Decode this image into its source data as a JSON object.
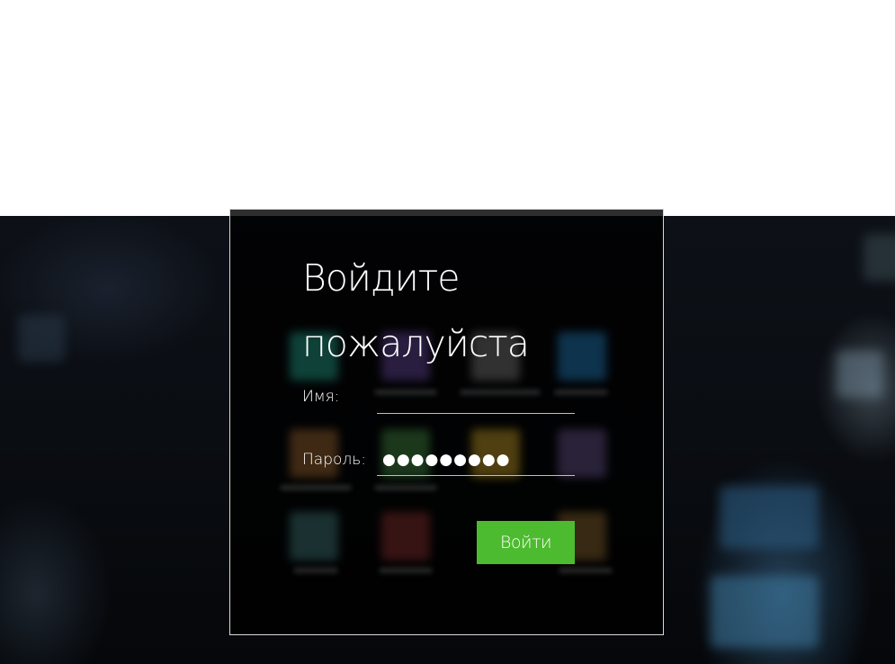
{
  "login": {
    "heading": "Войдите пожалуйста",
    "name_label": "Имя:",
    "name_value": "",
    "password_label": "Пароль:",
    "password_masked": "●●●●●●●●●",
    "submit_label": "Войти"
  },
  "colors": {
    "accent": "#4dbb2f",
    "panel_border": "#d8d8d8",
    "backdrop": "#0a0d12"
  }
}
